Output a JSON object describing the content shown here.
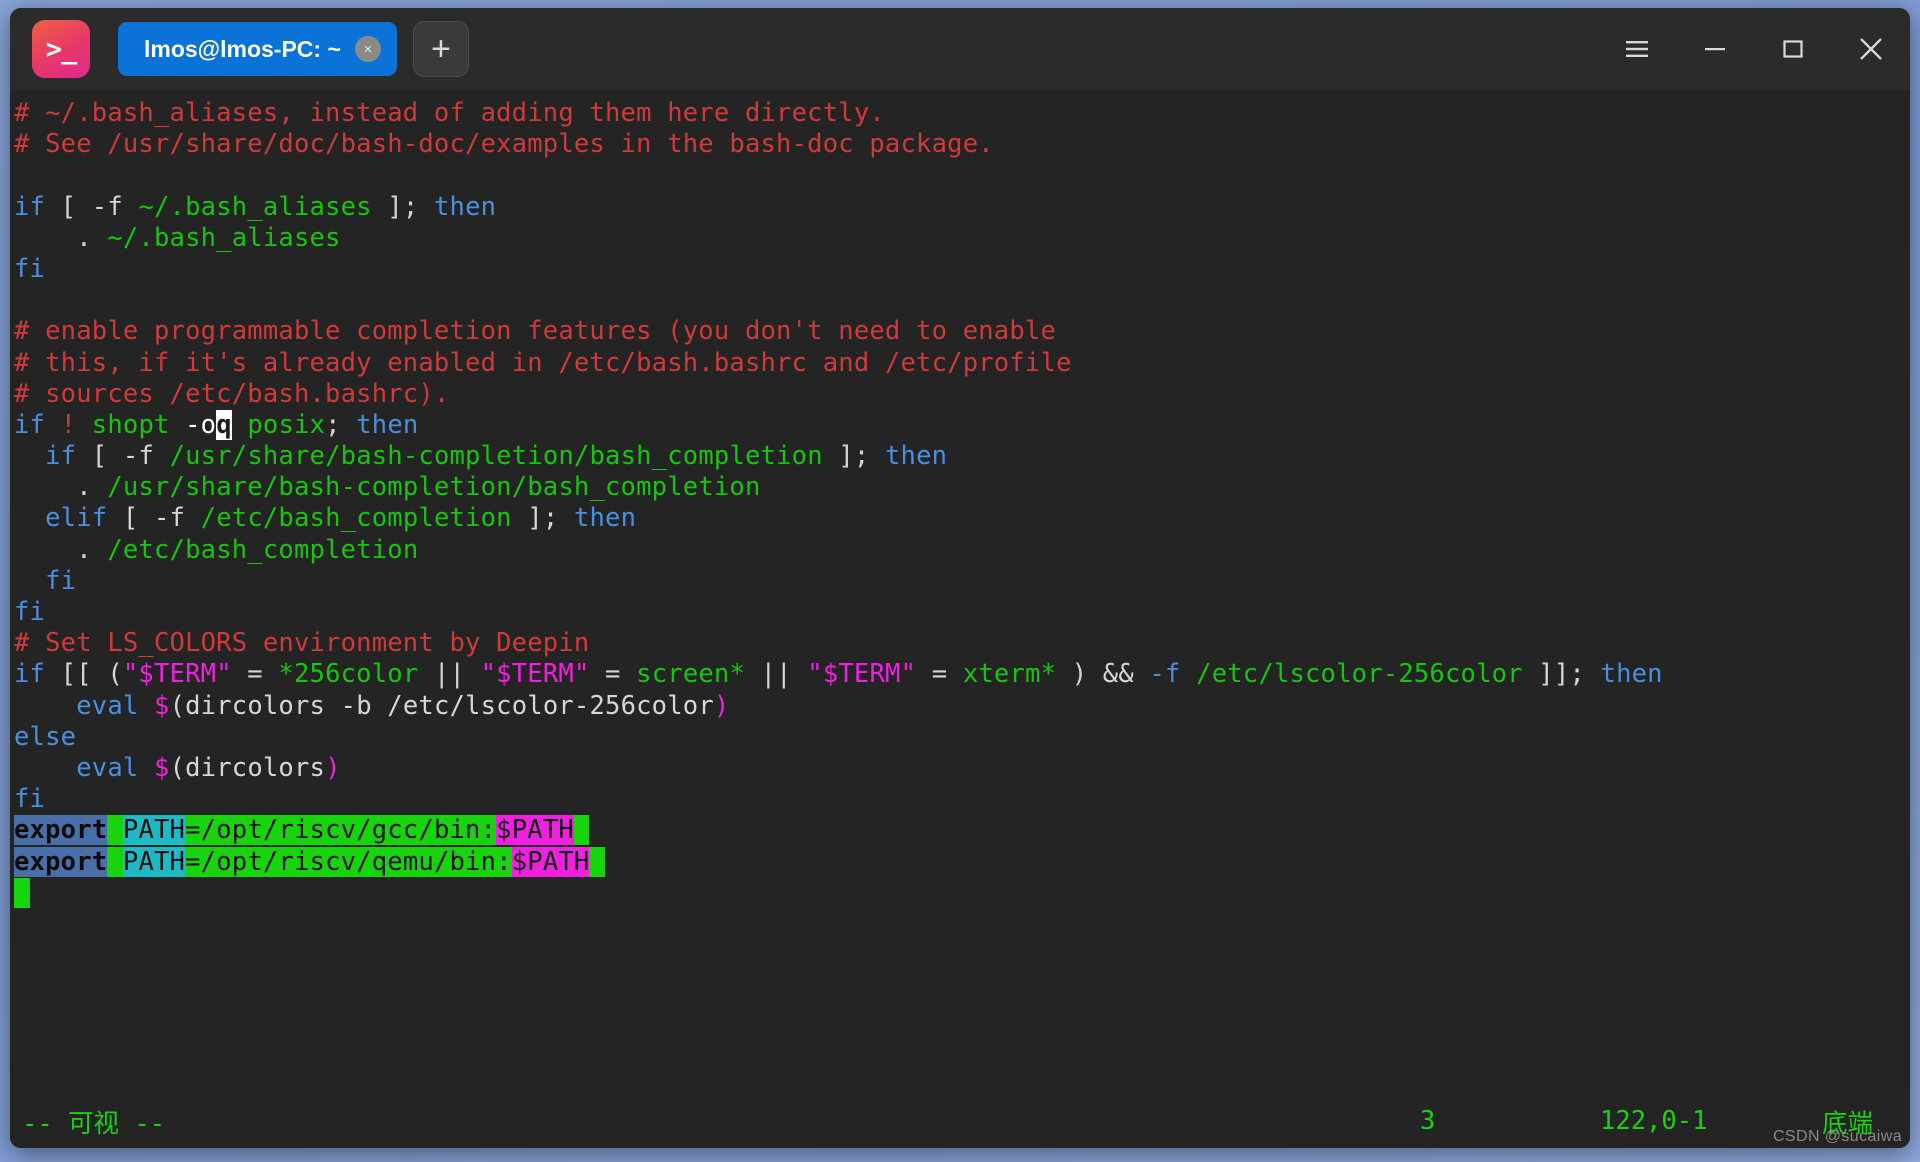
{
  "window": {
    "app_icon_glyph": ">_",
    "menu_icon": "hamburger-icon",
    "minimize_icon": "minimize-icon",
    "maximize_icon": "maximize-icon",
    "close_icon": "close-icon"
  },
  "tabs": [
    {
      "title": "lmos@lmos-PC: ~",
      "close_label": "×",
      "active": true
    }
  ],
  "new_tab_label": "+",
  "terminal": {
    "lines": [
      {
        "segs": [
          {
            "t": "# ~/.bash_aliases, instead of adding them here directly.",
            "c": "c-comment"
          }
        ]
      },
      {
        "segs": [
          {
            "t": "# See /usr/share/doc/bash-doc/examples in the bash-doc package.",
            "c": "c-comment"
          }
        ]
      },
      {
        "segs": [
          {
            "t": "",
            "c": "c-plain"
          }
        ]
      },
      {
        "segs": [
          {
            "t": "if",
            "c": "c-kw"
          },
          {
            "t": " [ ",
            "c": "c-plain"
          },
          {
            "t": "-f",
            "c": "c-plain"
          },
          {
            "t": " ",
            "c": "c-plain"
          },
          {
            "t": "~/.bash_aliases",
            "c": "c-str"
          },
          {
            "t": " ]; ",
            "c": "c-plain"
          },
          {
            "t": "then",
            "c": "c-kw"
          }
        ]
      },
      {
        "segs": [
          {
            "t": "    . ",
            "c": "c-plain"
          },
          {
            "t": "~/.bash_aliases",
            "c": "c-str"
          }
        ]
      },
      {
        "segs": [
          {
            "t": "fi",
            "c": "c-kw"
          }
        ]
      },
      {
        "segs": [
          {
            "t": "",
            "c": "c-plain"
          }
        ]
      },
      {
        "segs": [
          {
            "t": "# enable programmable completion features (you don't need to enable",
            "c": "c-comment"
          }
        ]
      },
      {
        "segs": [
          {
            "t": "# this, if it's already enabled in /etc/bash.bashrc and /etc/profile",
            "c": "c-comment"
          }
        ]
      },
      {
        "segs": [
          {
            "t": "# sources /etc/bash.bashrc).",
            "c": "c-comment"
          }
        ]
      },
      {
        "segs": [
          {
            "t": "if",
            "c": "c-kw"
          },
          {
            "t": " ",
            "c": "c-plain"
          },
          {
            "t": "!",
            "c": "c-comment"
          },
          {
            "t": " ",
            "c": "c-plain"
          },
          {
            "t": "shopt",
            "c": "c-str"
          },
          {
            "t": " ",
            "c": "c-plain"
          },
          {
            "t": "-o",
            "c": "c-white"
          },
          {
            "t": "q",
            "c": "cursor-blk"
          },
          {
            "t": " ",
            "c": "c-plain"
          },
          {
            "t": "posix",
            "c": "c-str"
          },
          {
            "t": "; ",
            "c": "c-plain"
          },
          {
            "t": "then",
            "c": "c-kw"
          }
        ]
      },
      {
        "segs": [
          {
            "t": "  ",
            "c": "c-plain"
          },
          {
            "t": "if",
            "c": "c-kw"
          },
          {
            "t": " [ ",
            "c": "c-plain"
          },
          {
            "t": "-f",
            "c": "c-plain"
          },
          {
            "t": " ",
            "c": "c-plain"
          },
          {
            "t": "/usr/share/bash-completion/bash_completion",
            "c": "c-str"
          },
          {
            "t": " ]; ",
            "c": "c-plain"
          },
          {
            "t": "then",
            "c": "c-kw"
          }
        ]
      },
      {
        "segs": [
          {
            "t": "    . ",
            "c": "c-plain"
          },
          {
            "t": "/usr/share/bash-completion/bash_completion",
            "c": "c-str"
          }
        ]
      },
      {
        "segs": [
          {
            "t": "  ",
            "c": "c-plain"
          },
          {
            "t": "elif",
            "c": "c-kw"
          },
          {
            "t": " [ ",
            "c": "c-plain"
          },
          {
            "t": "-f",
            "c": "c-plain"
          },
          {
            "t": " ",
            "c": "c-plain"
          },
          {
            "t": "/etc/bash_completion",
            "c": "c-str"
          },
          {
            "t": " ]; ",
            "c": "c-plain"
          },
          {
            "t": "then",
            "c": "c-kw"
          }
        ]
      },
      {
        "segs": [
          {
            "t": "    . ",
            "c": "c-plain"
          },
          {
            "t": "/etc/bash_completion",
            "c": "c-str"
          }
        ]
      },
      {
        "segs": [
          {
            "t": "  ",
            "c": "c-plain"
          },
          {
            "t": "fi",
            "c": "c-kw"
          }
        ]
      },
      {
        "segs": [
          {
            "t": "fi",
            "c": "c-kw"
          }
        ]
      },
      {
        "segs": [
          {
            "t": "# Set LS_COLORS environment by Deepin",
            "c": "c-comment"
          }
        ]
      },
      {
        "segs": [
          {
            "t": "if",
            "c": "c-kw"
          },
          {
            "t": " [[ (",
            "c": "c-plain"
          },
          {
            "t": "\"$TERM\"",
            "c": "c-var"
          },
          {
            "t": " = ",
            "c": "c-plain"
          },
          {
            "t": "*256color",
            "c": "c-str"
          },
          {
            "t": " || ",
            "c": "c-plain"
          },
          {
            "t": "\"$TERM\"",
            "c": "c-var"
          },
          {
            "t": " = ",
            "c": "c-plain"
          },
          {
            "t": "screen*",
            "c": "c-str"
          },
          {
            "t": " || ",
            "c": "c-plain"
          },
          {
            "t": "\"$TERM\"",
            "c": "c-var"
          },
          {
            "t": " = ",
            "c": "c-plain"
          },
          {
            "t": "xterm*",
            "c": "c-str"
          },
          {
            "t": " ) && ",
            "c": "c-plain"
          },
          {
            "t": "-f",
            "c": "c-kw"
          },
          {
            "t": " ",
            "c": "c-plain"
          },
          {
            "t": "/etc/lscolor-256color",
            "c": "c-str"
          },
          {
            "t": " ]]; ",
            "c": "c-plain"
          },
          {
            "t": "then",
            "c": "c-kw"
          }
        ]
      },
      {
        "segs": [
          {
            "t": "    ",
            "c": "c-plain"
          },
          {
            "t": "eval",
            "c": "c-kw"
          },
          {
            "t": " ",
            "c": "c-plain"
          },
          {
            "t": "$",
            "c": "c-var"
          },
          {
            "t": "(dircolors -b /etc/lscolor-256color",
            "c": "c-plain"
          },
          {
            "t": ")",
            "c": "c-var"
          }
        ]
      },
      {
        "segs": [
          {
            "t": "else",
            "c": "c-kw"
          }
        ]
      },
      {
        "segs": [
          {
            "t": "    ",
            "c": "c-plain"
          },
          {
            "t": "eval",
            "c": "c-kw"
          },
          {
            "t": " ",
            "c": "c-plain"
          },
          {
            "t": "$",
            "c": "c-var"
          },
          {
            "t": "(dircolors",
            "c": "c-plain"
          },
          {
            "t": ")",
            "c": "c-var"
          }
        ]
      },
      {
        "segs": [
          {
            "t": "fi",
            "c": "c-kw"
          }
        ]
      },
      {
        "segs": [
          {
            "t": "export",
            "c": "sel-export"
          },
          {
            "t": " ",
            "c": "sel-green"
          },
          {
            "t": "PATH",
            "c": "sel-cyan"
          },
          {
            "t": "=/opt/riscv/gcc/bin:",
            "c": "sel-green"
          },
          {
            "t": "$PATH",
            "c": "sel-magenta"
          },
          {
            "t": " ",
            "c": "sel-green"
          }
        ]
      },
      {
        "segs": [
          {
            "t": "export",
            "c": "sel-export"
          },
          {
            "t": " ",
            "c": "sel-green"
          },
          {
            "t": "PATH",
            "c": "sel-cyan"
          },
          {
            "t": "=/opt/riscv/qemu/bin:",
            "c": "sel-green"
          },
          {
            "t": "$PATH",
            "c": "sel-magenta"
          },
          {
            "t": " ",
            "c": "sel-green"
          }
        ]
      },
      {
        "segs": [
          {
            "t": " ",
            "c": "cursor-green"
          }
        ]
      }
    ]
  },
  "statusline": {
    "mode": "-- 可视 --",
    "count": "3",
    "position": "122,0-1",
    "location": "底端"
  },
  "watermark": "CSDN @sucaiwa",
  "colors": {
    "accent_tab": "#0b72d8",
    "titlebar_bg": "#2b2b2b",
    "terminal_bg": "#242424",
    "comment": "#cf3a3a",
    "keyword": "#4a8fe0",
    "string": "#16c60c",
    "variable": "#f020e0",
    "select_green": "#17d40c",
    "select_cyan": "#1fb9c4",
    "select_blue": "#4a6fa8",
    "status_green": "#17d40c"
  }
}
